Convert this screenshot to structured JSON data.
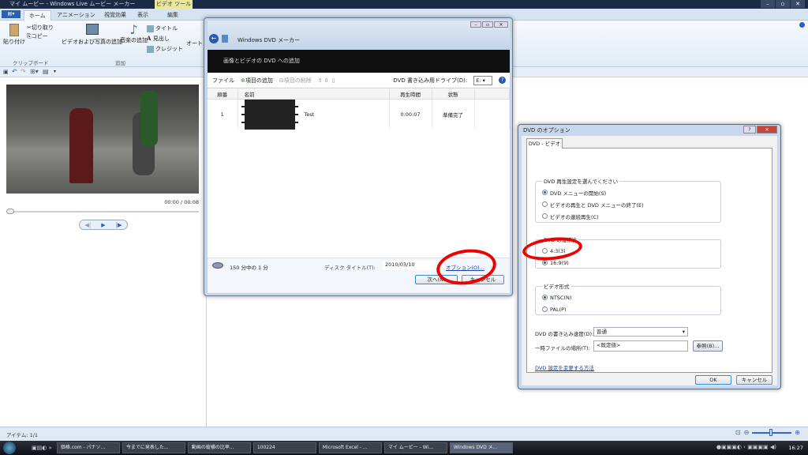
{
  "app": {
    "title": "マイ ムービー - Windows Live ムービー メーカー",
    "context_tab_group": "ビデオ ツール",
    "window_buttons": [
      "–",
      "▫",
      "✕"
    ]
  },
  "ribbon": {
    "tabs": [
      "ホーム",
      "アニメーション",
      "視覚効果",
      "表示",
      "編集"
    ],
    "active_tab": "ホーム",
    "paste": "貼り付け",
    "cut": "切り取り",
    "copy": "コピー",
    "group_clipboard": "クリップボード",
    "add_video": "ビデオおよび写真の追加",
    "add_music": "音楽の追加",
    "title": "タイトル",
    "caption": "見出し",
    "credits": "クレジット",
    "group_add": "追加",
    "auto": "オート"
  },
  "preview": {
    "time": "00:00 / 00:08"
  },
  "status": {
    "items": "アイテム: 1/1"
  },
  "dvd_maker": {
    "title": "Windows DVD メーカー",
    "banner": "画像とビデオの DVD への追加",
    "toolbar": {
      "file": "ファイル",
      "add_item": "項目の追加",
      "remove_item": "項目の削除",
      "drive_label": "DVD 書き込み用ドライブ(D):",
      "drive_value": "E:"
    },
    "columns": [
      "順番",
      "名前",
      "再生時間",
      "状態"
    ],
    "rows": [
      {
        "order": "1",
        "name": "Test",
        "duration": "0:00:07",
        "status": "準備完了"
      }
    ],
    "capacity": "150 分中の 1 分",
    "disc_title_label": "ディスク タイトル(T):",
    "disc_title_value": "2010/03/10",
    "options_link": "オプション(O)...",
    "next": "次へ(N)",
    "cancel": "キャンセル"
  },
  "options_dialog": {
    "title": "DVD のオプション",
    "tab": "DVD - ビデオ",
    "playback": {
      "legend": "DVD 再生設定を選んでください",
      "options": [
        "DVD メニューの開始(S)",
        "ビデオの再生と DVD メニューの終了(E)",
        "ビデオの連続再生(C)"
      ],
      "selected": 0
    },
    "aspect": {
      "legend": "DVD の縦横比",
      "options": [
        "4:3(3)",
        "16:9(9)"
      ],
      "selected": 1
    },
    "format": {
      "legend": "ビデオ形式",
      "options": [
        "NTSC(N)",
        "PAL(P)"
      ],
      "selected": 0
    },
    "speed_label": "DVD の書き込み速度(D):",
    "speed_value": "普通",
    "temp_label": "一時ファイルの場所(T):",
    "temp_value": "<既定値>",
    "browse": "参照(B)...",
    "help_link": "DVD 設定を変更する方法",
    "ok": "OK",
    "cancel": "キャンセル",
    "help_btn": "?",
    "close_btn": "✕"
  },
  "taskbar": {
    "items": [
      "価格.com - パナソ...",
      "今までに発表した...",
      "動画の縦横の比率...",
      "100224",
      "Microsoft Excel - ...",
      "マイ ムービー - Wi...",
      "Windows DVD メ..."
    ],
    "active": 6,
    "clock": "16:27"
  },
  "colors": {
    "annotation": "#e00000",
    "link": "#1a3ea8"
  }
}
